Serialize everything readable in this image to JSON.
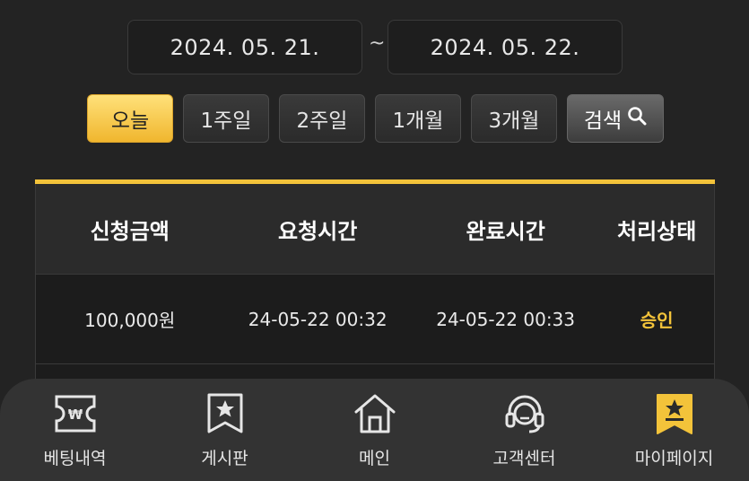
{
  "date_range": {
    "start": "2024. 05. 21.",
    "separator": "~",
    "end": "2024. 05. 22."
  },
  "period_buttons": [
    {
      "label": "오늘",
      "active": true
    },
    {
      "label": "1주일",
      "active": false
    },
    {
      "label": "2주일",
      "active": false
    },
    {
      "label": "1개월",
      "active": false
    },
    {
      "label": "3개월",
      "active": false
    }
  ],
  "search_button": {
    "label": "검색",
    "icon": "search-icon"
  },
  "table": {
    "headers": [
      "신청금액",
      "요청시간",
      "완료시간",
      "처리상태"
    ],
    "rows": [
      [
        "100,000원",
        "24-05-22 00:32",
        "24-05-22 00:33",
        "승인"
      ]
    ]
  },
  "colors": {
    "accent": "#f3c33a",
    "background": "#232323",
    "nav": "#333333"
  },
  "bottom_nav": [
    {
      "label": "베팅내역",
      "icon": "ticket-won-icon"
    },
    {
      "label": "게시판",
      "icon": "board-star-icon"
    },
    {
      "label": "메인",
      "icon": "home-icon"
    },
    {
      "label": "고객센터",
      "icon": "headset-icon"
    },
    {
      "label": "마이페이지",
      "icon": "mypage-badge-icon",
      "active": true
    }
  ]
}
